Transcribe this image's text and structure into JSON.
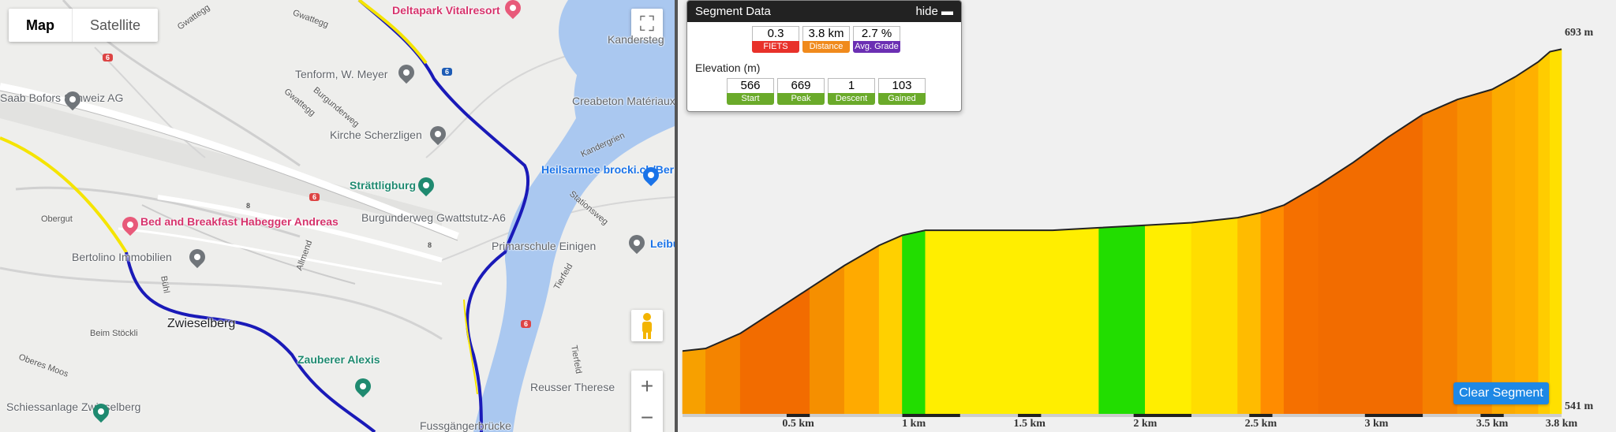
{
  "map": {
    "type_tabs": [
      "Map",
      "Satellite"
    ],
    "active_tab": "Map",
    "zoom_in": "+",
    "zoom_out": "−",
    "fullscreen_glyph": "⛶",
    "pois": [
      {
        "name": "Deltapark Vitalresort",
        "kind": "pink"
      },
      {
        "name": "Kandersteg",
        "kind": "gray"
      },
      {
        "name": "Tenform, W. Meyer",
        "kind": "gray"
      },
      {
        "name": "Saab Bofors Schweiz AG",
        "kind": "gray"
      },
      {
        "name": "Creabeton Matériaux AG/SA",
        "kind": "gray"
      },
      {
        "name": "Kirche Scherzligen",
        "kind": "gray"
      },
      {
        "name": "Heilsarmee brocki.ch/Berner Oberland",
        "kind": "blue"
      },
      {
        "name": "Strättligburg",
        "kind": "teal"
      },
      {
        "name": "Bed and Breakfast Habegger Andreas",
        "kind": "pink"
      },
      {
        "name": "Burgunderweg Gwattstutz-A6",
        "kind": "gray"
      },
      {
        "name": "Primarschule Einigen",
        "kind": "gray"
      },
      {
        "name": "Leibund",
        "kind": "blue"
      },
      {
        "name": "Bertolino Immobilien",
        "kind": "gray"
      },
      {
        "name": "Zwieselberg",
        "kind": "dark"
      },
      {
        "name": "Zauberer Alexis",
        "kind": "teal"
      },
      {
        "name": "Reusser Therese",
        "kind": "gray"
      },
      {
        "name": "Schiessanlage Zwieselberg",
        "kind": "gray"
      },
      {
        "name": "Fussgängerbrücke",
        "kind": "gray"
      }
    ],
    "streets": [
      "Gwattegg",
      "Gwattegg",
      "Burgunderweg",
      "Gwattegg",
      "Obergut",
      "Allmend",
      "Bühl",
      "Beim Stöckli",
      "Oberes Moos",
      "Stationsweg",
      "Kandergrien",
      "Tierfeld",
      "Tierfeld"
    ],
    "shields": [
      "6",
      "6",
      "6",
      "6",
      "8",
      "8"
    ],
    "colors": {
      "route": "#1a1ab8",
      "route_alt": "#f5e400",
      "water": "#aac8f0"
    }
  },
  "segment": {
    "title": "Segment Data",
    "hide_label": "hide",
    "summary": [
      {
        "value": "0.3",
        "label": "FIETS",
        "color": "#e8312a"
      },
      {
        "value": "3.8 km",
        "label": "Distance",
        "color": "#f08a1c"
      },
      {
        "value": "2.7 %",
        "label": "Avg. Grade",
        "color": "#6b2fb3"
      }
    ],
    "elevation_title": "Elevation (m)",
    "elevation": [
      {
        "value": "566",
        "label": "Start",
        "color": "#6aaa2a"
      },
      {
        "value": "669",
        "label": "Peak",
        "color": "#6aaa2a"
      },
      {
        "value": "1",
        "label": "Descent",
        "color": "#6aaa2a"
      },
      {
        "value": "103",
        "label": "Gained",
        "color": "#6aaa2a"
      }
    ]
  },
  "clear_button": "Clear Segment",
  "chart_data": {
    "type": "area",
    "y_max_label": "693 m",
    "y_min_label": "541 m",
    "ylim": [
      541,
      693
    ],
    "x_tick_labels": [
      "0.5 km",
      "1 km",
      "1.5 km",
      "2 km",
      "2.5 km",
      "3 km",
      "3.5 km",
      "3.8 km"
    ],
    "x_ticks": [
      0.5,
      1.0,
      1.5,
      2.0,
      2.5,
      3.0,
      3.5,
      3.8
    ],
    "xlim": [
      0,
      3.8
    ],
    "x": [
      0,
      0.1,
      0.25,
      0.4,
      0.55,
      0.7,
      0.85,
      0.95,
      1.05,
      1.2,
      1.4,
      1.6,
      1.8,
      2.0,
      2.2,
      2.4,
      2.5,
      2.6,
      2.75,
      2.9,
      3.05,
      3.2,
      3.35,
      3.5,
      3.6,
      3.7,
      3.75,
      3.8
    ],
    "y": [
      566,
      567,
      573,
      582,
      591,
      600,
      608,
      612,
      614,
      614,
      614,
      614,
      615,
      616,
      617,
      619,
      621,
      624,
      632,
      641,
      651,
      660,
      666,
      670,
      675,
      681,
      685,
      686
    ],
    "grade_colors": [
      "#f7a000",
      "#f48400",
      "#f26c00",
      "#f26c00",
      "#f58f00",
      "#ffaa00",
      "#ffd000",
      "#22dd00",
      "#ffee00",
      "#ffee00",
      "#ffee00",
      "#ffee00",
      "#22dd00",
      "#ffee00",
      "#ffdd00",
      "#ffbb00",
      "#ff8c00",
      "#f57000",
      "#f26c00",
      "#f26c00",
      "#f26c00",
      "#f58000",
      "#f89000",
      "#fbaa00",
      "#ffb000",
      "#ffcc00",
      "#ffe000"
    ]
  }
}
